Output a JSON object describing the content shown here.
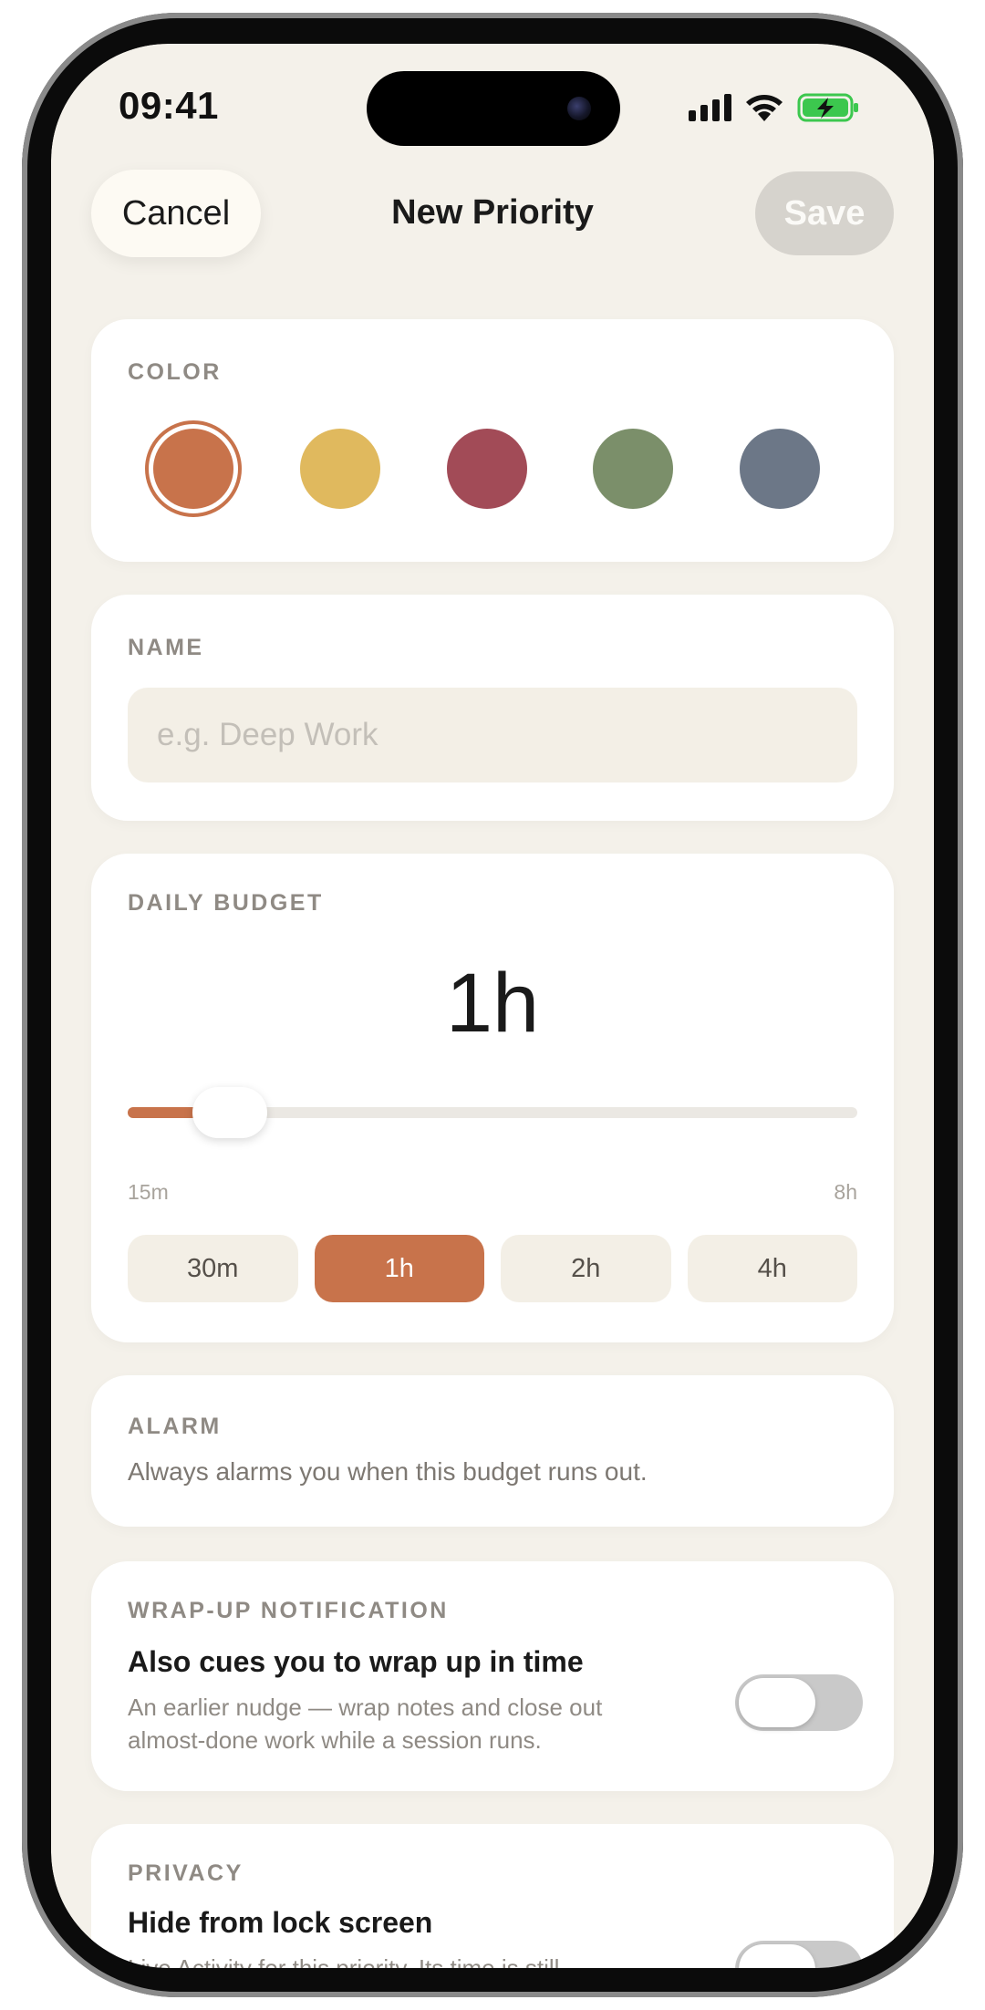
{
  "status_bar": {
    "time": "09:41"
  },
  "header": {
    "cancel_label": "Cancel",
    "title": "New Priority",
    "save_label": "Save"
  },
  "color_section": {
    "label": "COLOR",
    "swatches": [
      {
        "name": "orange",
        "hex": "#c8734b",
        "selected": true
      },
      {
        "name": "yellow",
        "hex": "#e0b95e"
      },
      {
        "name": "crimson",
        "hex": "#a24b57"
      },
      {
        "name": "sage",
        "hex": "#7b8f6a"
      },
      {
        "name": "slate",
        "hex": "#6c7787"
      }
    ]
  },
  "name_section": {
    "label": "NAME",
    "placeholder": "e.g. Deep Work",
    "value": ""
  },
  "budget_section": {
    "label": "DAILY BUDGET",
    "value": "1h",
    "slider_fraction": 0.09,
    "min_label": "15m",
    "max_label": "8h",
    "presets": [
      {
        "label": "30m",
        "active": false
      },
      {
        "label": "1h",
        "active": true
      },
      {
        "label": "2h",
        "active": false
      },
      {
        "label": "4h",
        "active": false
      }
    ]
  },
  "alarm_section": {
    "label": "ALARM",
    "description": "Always alarms you when this budget runs out."
  },
  "wrapup_section": {
    "label": "WRAP-UP NOTIFICATION",
    "title": "Also cues you to wrap up in time",
    "description": "An earlier nudge — wrap notes and close out almost-done work while a session runs.",
    "enabled": false
  },
  "privacy_section": {
    "label": "PRIVACY",
    "title": "Hide from lock screen",
    "description": "Live Activity for this priority. Its time is still",
    "enabled": false
  },
  "colors": {
    "accent": "#c8734b",
    "background": "#f4f1ea",
    "card": "#ffffff"
  }
}
